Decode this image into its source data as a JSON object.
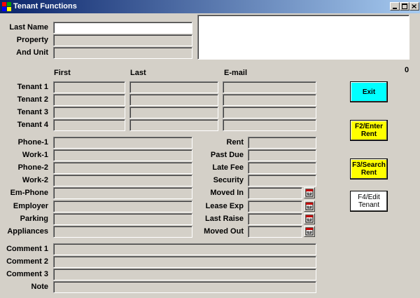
{
  "window": {
    "title": "Tenant Functions"
  },
  "labels": {
    "last_name": "Last Name",
    "property": "Property",
    "and_unit": "And Unit",
    "first": "First",
    "last": "Last",
    "email": "E-mail",
    "tenant1": "Tenant 1",
    "tenant2": "Tenant 2",
    "tenant3": "Tenant 3",
    "tenant4": "Tenant 4",
    "phone1": "Phone-1",
    "work1": "Work-1",
    "phone2": "Phone-2",
    "work2": "Work-2",
    "em_phone": "Em-Phone",
    "employer": "Employer",
    "parking": "Parking",
    "appliances": "Appliances",
    "rent": "Rent",
    "past_due": "Past Due",
    "late_fee": "Late Fee",
    "security": "Security",
    "moved_in": "Moved In",
    "lease_exp": "Lease Exp",
    "last_raise": "Last Raise",
    "moved_out": "Moved Out",
    "comment1": "Comment 1",
    "comment2": "Comment 2",
    "comment3": "Comment 3",
    "note": "Note"
  },
  "counter": "0",
  "buttons": {
    "exit": "Exit",
    "enter_rent": "F2/Enter\nRent",
    "search_rent": "F3/Search\nRent",
    "edit_tenant": "F4/Edit\nTenant"
  },
  "colors": {
    "exit": "#00ffff",
    "enter_rent": "#ffff00",
    "search_rent": "#ffff00",
    "edit_tenant": "#ffffff",
    "title_start": "#0a246a",
    "title_end": "#a6caf0"
  },
  "icons": {
    "app": "app-icon",
    "calendar": "calendar-icon",
    "minimize": "minimize-icon",
    "maximize": "maximize-icon",
    "close": "close-icon"
  }
}
